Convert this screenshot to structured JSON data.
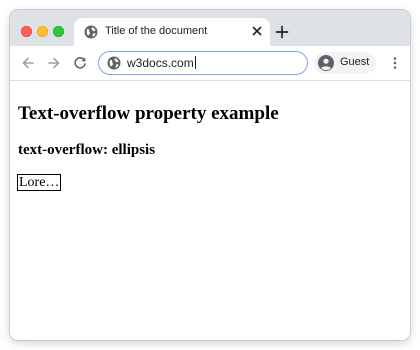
{
  "browser": {
    "tab": {
      "title": "Title of the document",
      "icon": "globe-icon"
    },
    "address_bar": {
      "url": "w3docs.com",
      "icon": "globe-icon"
    },
    "profile": {
      "label": "Guest",
      "icon": "person-icon"
    },
    "controls": [
      "back-arrow-icon",
      "forward-arrow-icon",
      "reload-icon",
      "close-icon",
      "plus-icon",
      "kebab-menu-icon"
    ],
    "colors": {
      "titlebar": "#dee1e6",
      "traffic_red": "#fe5f57",
      "traffic_yellow": "#febc2e",
      "traffic_green": "#28c840",
      "omnibox_focus": "#7fa6e8"
    }
  },
  "page": {
    "heading": "Text-overflow property example",
    "subheading": "text-overflow: ellipsis",
    "ellipsis_text": "Lore…"
  }
}
